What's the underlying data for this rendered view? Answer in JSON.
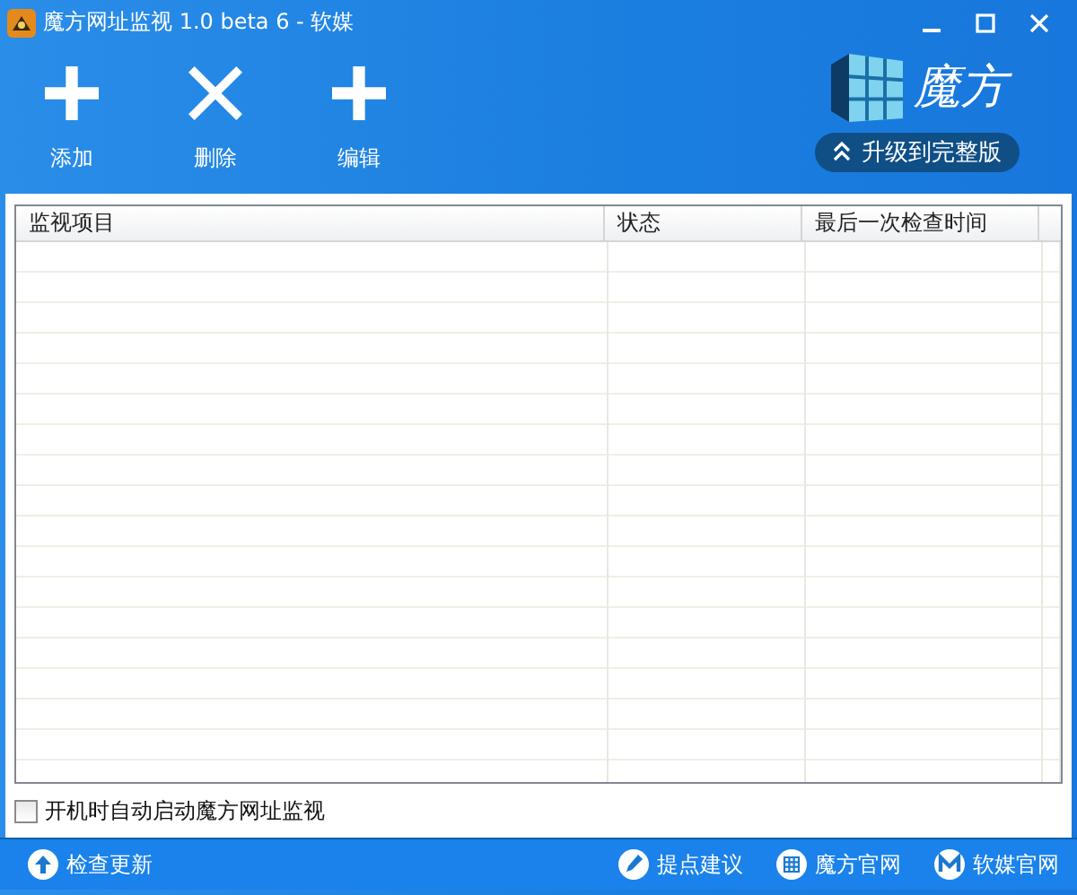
{
  "window": {
    "title": "魔方网址监视 1.0 beta 6 - 软媒"
  },
  "toolbar": [
    {
      "kind": "plus",
      "label": "添加"
    },
    {
      "kind": "cross",
      "label": "删除"
    },
    {
      "kind": "plus",
      "label": "编辑"
    }
  ],
  "brand": {
    "name": "魔方",
    "upgrade": "升级到完整版"
  },
  "table": {
    "columns": [
      "监视项目",
      "状态",
      "最后一次检查时间"
    ]
  },
  "autostart": {
    "label": "开机时自动启动魔方网址监视",
    "checked": false
  },
  "status_bar": {
    "left": {
      "kind": "update",
      "label": "检查更新"
    },
    "links": [
      {
        "kind": "pen",
        "label": "提点建议"
      },
      {
        "kind": "grid",
        "label": "魔方官网"
      },
      {
        "kind": "m",
        "label": "软媒官网"
      }
    ]
  }
}
